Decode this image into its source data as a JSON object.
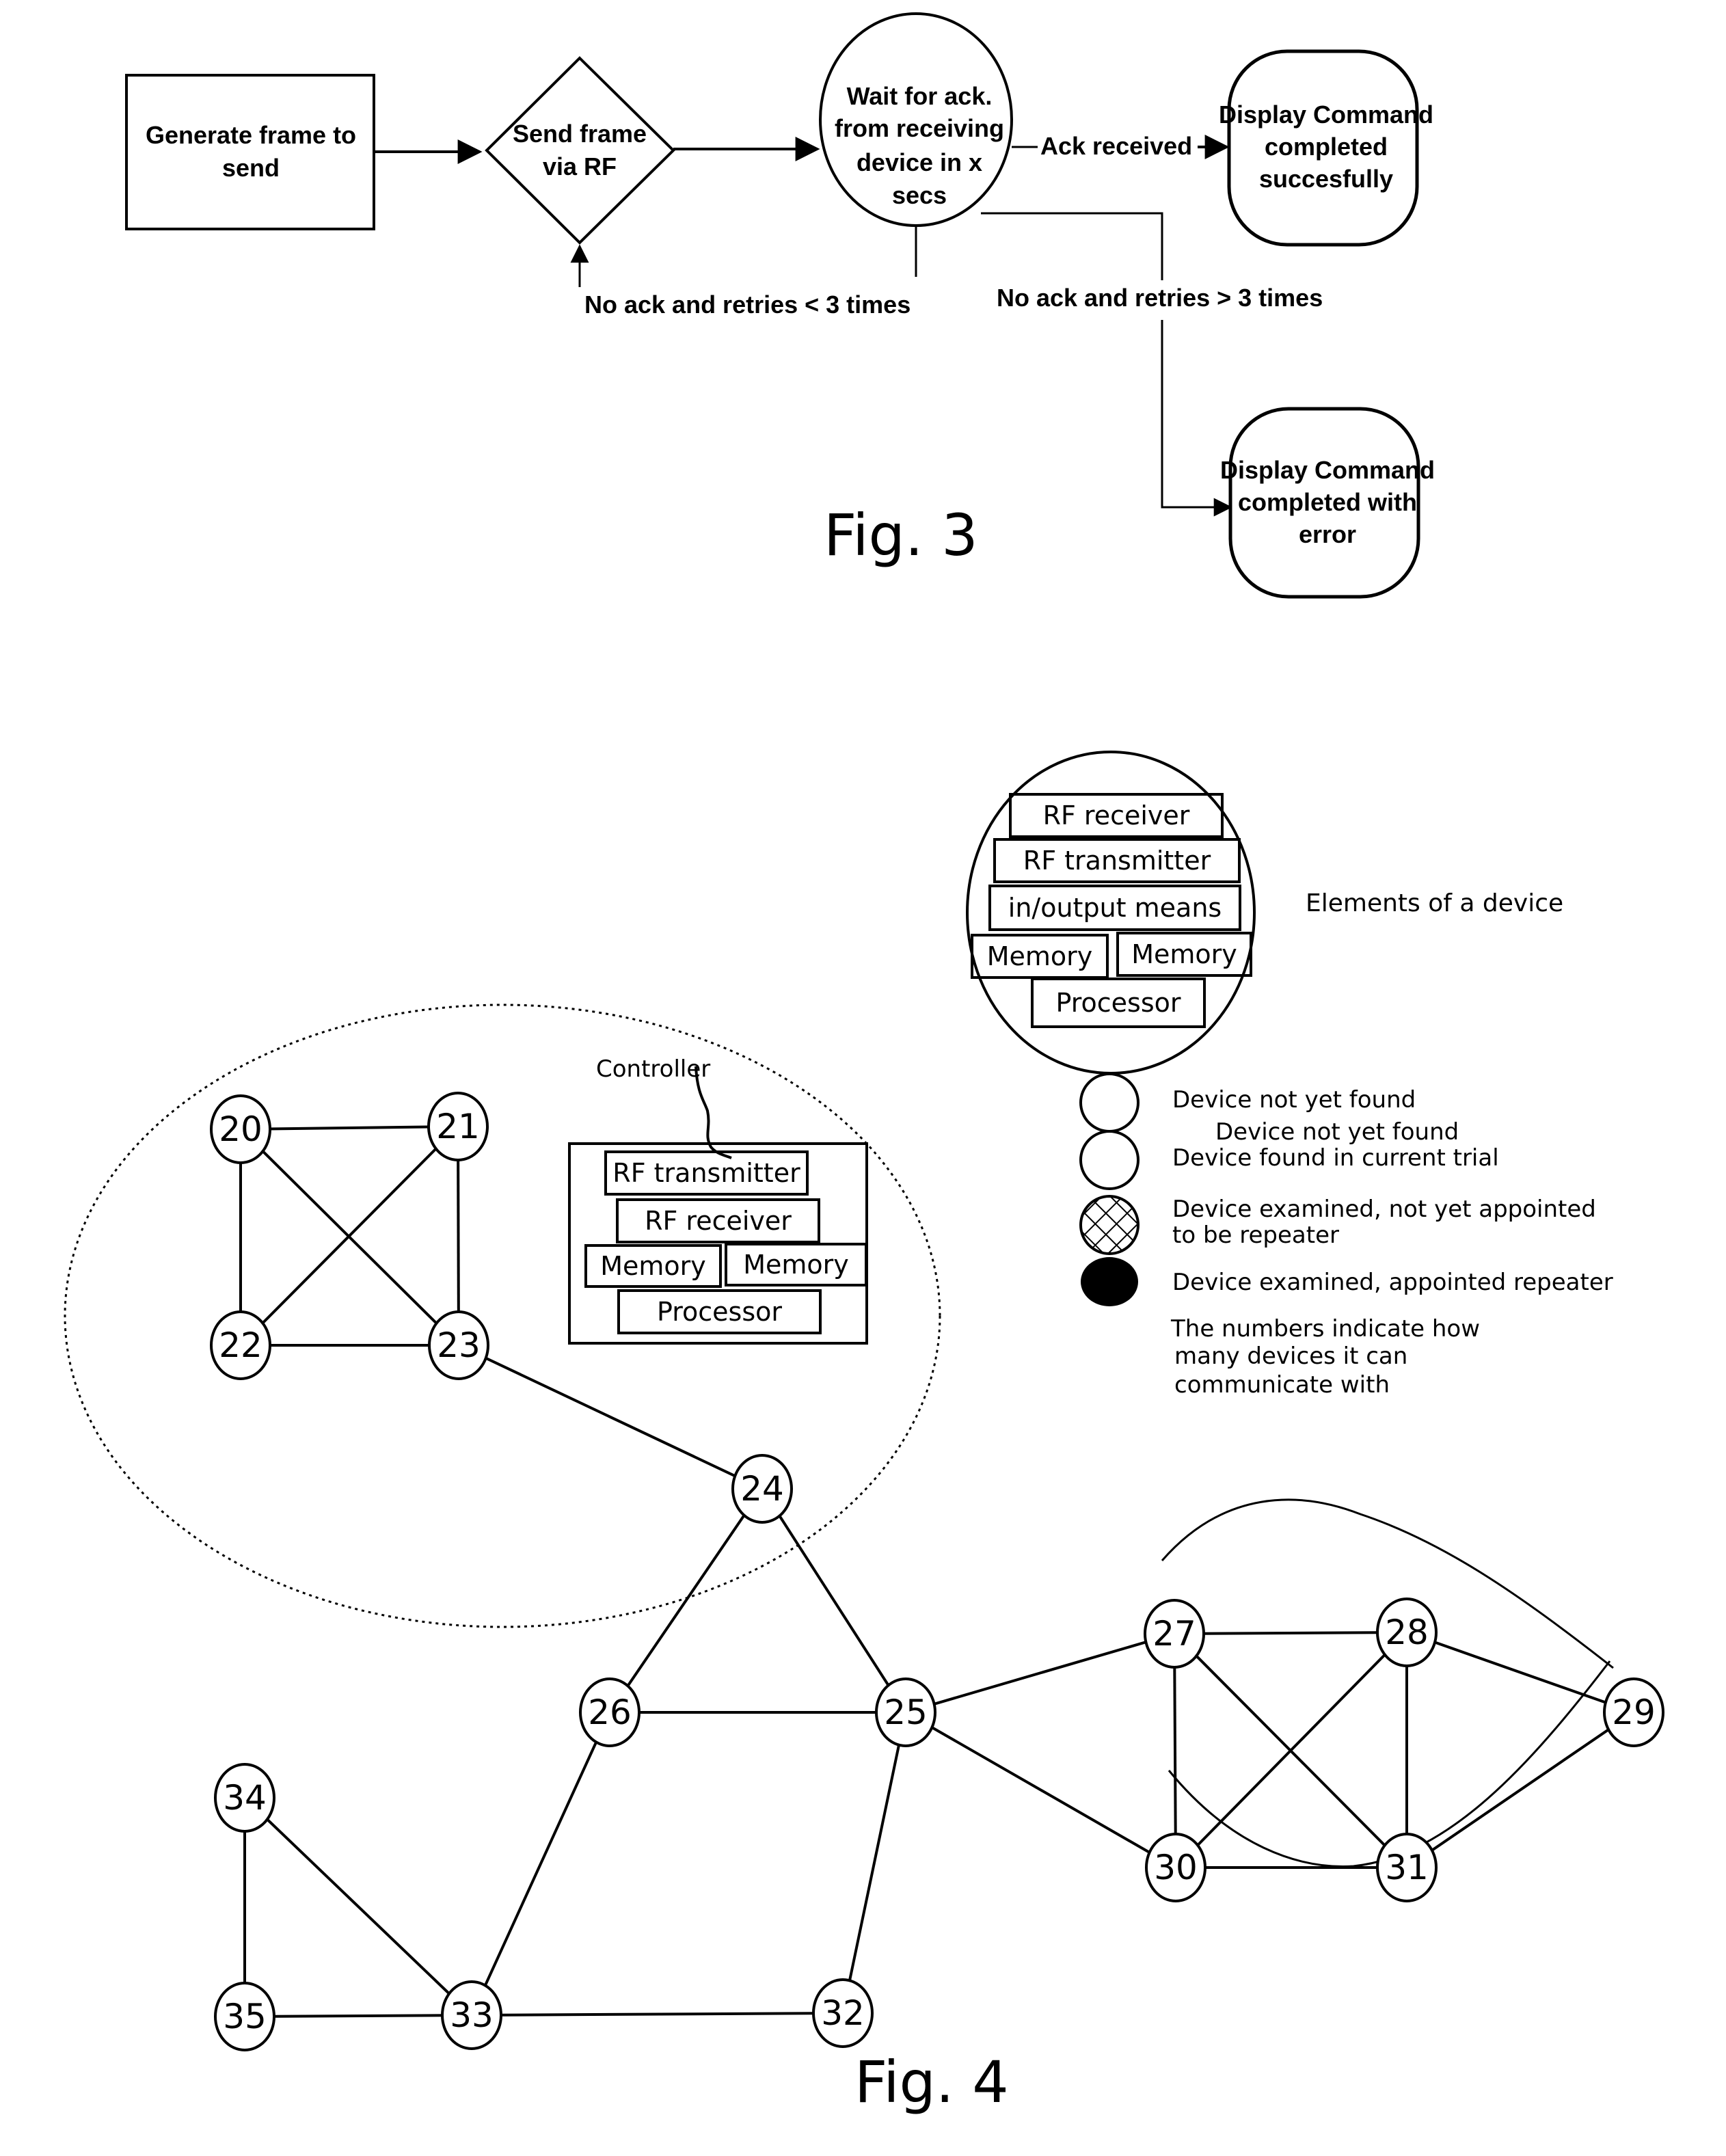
{
  "figure3": {
    "caption": "Fig. 3",
    "nodes": {
      "generate": [
        "Generate frame to",
        "send"
      ],
      "send": [
        "Send frame",
        "via RF"
      ],
      "wait": [
        "Wait for ack.",
        "from receiving",
        "device in x",
        "secs"
      ],
      "success": [
        "Display Command",
        "completed",
        "succesfully"
      ],
      "error": [
        "Display Command",
        "completed with",
        "error"
      ]
    },
    "edges": {
      "ack_received": "Ack received",
      "retry_loop": "No ack and retries < 3 times",
      "fail": "No ack and retries > 3 times"
    }
  },
  "figure4": {
    "caption": "Fig. 4",
    "device_elements": {
      "items": [
        "RF receiver",
        "RF transmitter",
        "in/output means",
        "Memory",
        "Memory",
        "Processor"
      ],
      "caption": "Elements of a device"
    },
    "controller": {
      "label": "Controller",
      "items": [
        "RF transmitter",
        "RF receiver",
        "Memory",
        "Memory",
        "Processor"
      ]
    },
    "legend": [
      {
        "symbol": "empty-circle",
        "text": [
          "Device not yet found"
        ]
      },
      {
        "symbol": "empty-circle",
        "text": [
          "Device not yet found",
          "Device found in current trial"
        ]
      },
      {
        "symbol": "hatched-circle",
        "text": [
          "Device examined, not yet appointed",
          "to be repeater"
        ]
      },
      {
        "symbol": "filled-circle",
        "text": [
          "Device examined, appointed repeater"
        ]
      }
    ],
    "note": [
      "The numbers indicate how",
      "many devices it can",
      "communicate with"
    ],
    "nodes": [
      "20",
      "21",
      "22",
      "23",
      "24",
      "25",
      "26",
      "27",
      "28",
      "29",
      "30",
      "31",
      "32",
      "33",
      "34",
      "35"
    ],
    "edges": [
      [
        "20",
        "21"
      ],
      [
        "20",
        "22"
      ],
      [
        "20",
        "23"
      ],
      [
        "21",
        "22"
      ],
      [
        "21",
        "23"
      ],
      [
        "22",
        "23"
      ],
      [
        "23",
        "24"
      ],
      [
        "24",
        "26"
      ],
      [
        "24",
        "25"
      ],
      [
        "26",
        "25"
      ],
      [
        "26",
        "33"
      ],
      [
        "25",
        "27"
      ],
      [
        "25",
        "30"
      ],
      [
        "25",
        "32"
      ],
      [
        "27",
        "28"
      ],
      [
        "27",
        "30"
      ],
      [
        "27",
        "31"
      ],
      [
        "28",
        "30"
      ],
      [
        "28",
        "31"
      ],
      [
        "28",
        "29"
      ],
      [
        "29",
        "31"
      ],
      [
        "30",
        "31"
      ],
      [
        "34",
        "35"
      ],
      [
        "34",
        "33"
      ],
      [
        "35",
        "33"
      ],
      [
        "33",
        "32"
      ]
    ]
  }
}
